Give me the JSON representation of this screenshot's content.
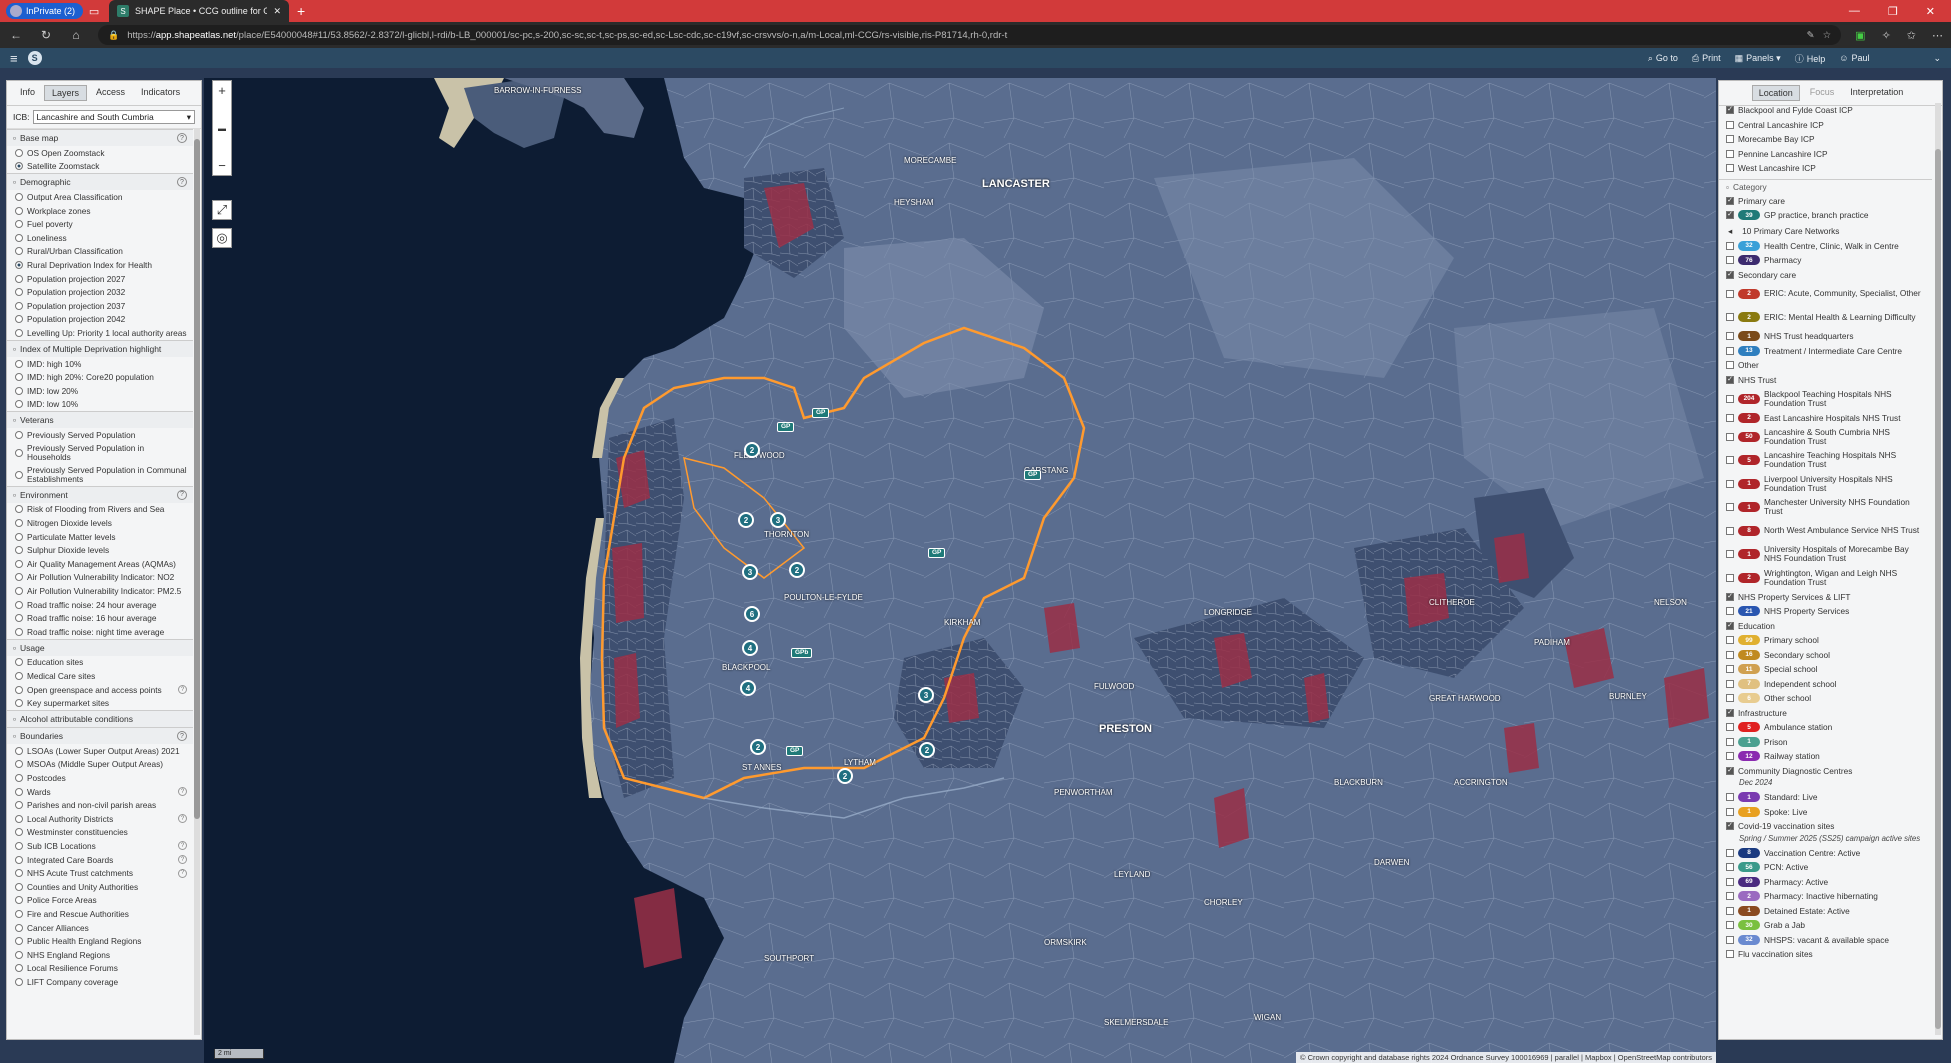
{
  "browser": {
    "private_label": "InPrivate (2)",
    "tab_title": "SHAPE Place • CCG outline for Gl",
    "url_prefix": "https://",
    "url_host": "app.shapeatlas.net",
    "url_path": "/place/E54000048#11/53.8562/-2.8372/l-glicbl,l-rdi/b-LB_000001/sc-pc,s-200,sc-sc,sc-t,sc-ps,sc-ed,sc-Lsc-cdc,sc-c19vf,sc-crsvvs/o-n,a/m-Local,ml-CCG/rs-visible,ris-P81714,rh-0,rdr-t"
  },
  "header": {
    "goto": "Go to",
    "print": "Print",
    "panels": "Panels",
    "help": "Help",
    "user": "Paul"
  },
  "left_panel": {
    "tabs": [
      "Info",
      "Layers",
      "Access",
      "Indicators"
    ],
    "active_tab": "Layers",
    "icb_label": "ICB:",
    "icb_value": "Lancashire and South Cumbria",
    "sections": [
      {
        "title": "Base map",
        "help": true,
        "items": [
          {
            "label": "OS Open Zoomstack",
            "on": false
          },
          {
            "label": "Satellite Zoomstack",
            "on": true
          }
        ]
      },
      {
        "title": "Demographic",
        "help": true,
        "items": [
          {
            "label": "Output Area Classification"
          },
          {
            "label": "Workplace zones"
          },
          {
            "label": "Fuel poverty"
          },
          {
            "label": "Loneliness"
          },
          {
            "label": "Rural/Urban Classification"
          },
          {
            "label": "Rural Deprivation Index for Health",
            "on": true
          },
          {
            "label": "Population projection 2027"
          },
          {
            "label": "Population projection 2032"
          },
          {
            "label": "Population projection 2037"
          },
          {
            "label": "Population projection 2042"
          },
          {
            "label": "Levelling Up: Priority 1 local authority areas"
          }
        ]
      },
      {
        "title": "Index of Multiple Deprivation highlight",
        "items": [
          {
            "label": "IMD: high 10%"
          },
          {
            "label": "IMD: high 20%: Core20 population"
          },
          {
            "label": "IMD: low 20%"
          },
          {
            "label": "IMD: low 10%"
          }
        ]
      },
      {
        "title": "Veterans",
        "items": [
          {
            "label": "Previously Served Population"
          },
          {
            "label": "Previously Served Population in Households",
            "tall": true
          },
          {
            "label": "Previously Served Population in Communal Establishments",
            "tall": true
          }
        ]
      },
      {
        "title": "Environment",
        "help": true,
        "items": [
          {
            "label": "Risk of Flooding from Rivers and Sea"
          },
          {
            "label": "Nitrogen Dioxide levels"
          },
          {
            "label": "Particulate Matter levels"
          },
          {
            "label": "Sulphur Dioxide levels"
          },
          {
            "label": "Air Quality Management Areas (AQMAs)"
          },
          {
            "label": "Air Pollution Vulnerability Indicator: NO2"
          },
          {
            "label": "Air Pollution Vulnerability Indicator: PM2.5"
          },
          {
            "label": "Road traffic noise: 24 hour average"
          },
          {
            "label": "Road traffic noise: 16 hour average"
          },
          {
            "label": "Road traffic noise: night time average"
          }
        ]
      },
      {
        "title": "Usage",
        "items": [
          {
            "label": "Education sites"
          },
          {
            "label": "Medical Care sites"
          },
          {
            "label": "Open greenspace and access points",
            "help": true
          },
          {
            "label": "Key supermarket sites"
          }
        ]
      },
      {
        "title": "Alcohol attributable conditions",
        "items": []
      },
      {
        "title": "Boundaries",
        "help": true,
        "items": [
          {
            "label": "LSOAs (Lower Super Output Areas) 2021"
          },
          {
            "label": "MSOAs (Middle Super Output Areas)"
          },
          {
            "label": "Postcodes"
          },
          {
            "label": "Wards",
            "help": true
          },
          {
            "label": "Parishes and non-civil parish areas"
          },
          {
            "label": "Local Authority Districts",
            "help": true
          },
          {
            "label": "Westminster constituencies"
          },
          {
            "label": "Sub ICB Locations",
            "help": true
          },
          {
            "label": "Integrated Care Boards",
            "help": true
          },
          {
            "label": "NHS Acute Trust catchments",
            "help": true
          },
          {
            "label": "Counties and Unity Authorities"
          },
          {
            "label": "Police Force Areas"
          },
          {
            "label": "Fire and Rescue Authorities"
          },
          {
            "label": "Cancer Alliances"
          },
          {
            "label": "Public Health England Regions"
          },
          {
            "label": "NHS England Regions"
          },
          {
            "label": "Local Resilience Forums"
          },
          {
            "label": "LIFT Company coverage"
          }
        ]
      }
    ]
  },
  "map": {
    "scale": "2 mi",
    "attribution": "© Crown copyright and database rights 2024 Ordnance Survey 100016969 | parallel | Mapbox | OpenStreetMap contributors",
    "places": {
      "lancaster": "LANCASTER",
      "preston": "PRESTON",
      "blackpool": "BLACKPOOL",
      "fleetwood": "FLEETWOOD",
      "thornton": "THORNTON",
      "heysham": "HEYSHAM",
      "morecambe": "MORECAMBE",
      "st_annes": "ST ANNES",
      "lytham": "LYTHAM",
      "garstang": "GARSTANG",
      "fulwood": "FULWOOD",
      "chorley": "CHORLEY",
      "leyland": "LEYLAND",
      "blackburn": "BLACKBURN",
      "darwen": "DARWEN",
      "southport": "SOUTHPORT",
      "barrow": "BARROW-IN-FURNESS",
      "burnley": "BURNLEY",
      "accrington": "ACCRINGTON",
      "great_harwood": "GREAT HARWOOD",
      "clitheroe": "CLITHEROE",
      "longridge": "LONGRIDGE",
      "kirkham": "KIRKHAM",
      "poulton": "POULTON-LE-FYLDE",
      "nelson": "NELSON",
      "padiham": "PADIHAM",
      "wigan": "WIGAN",
      "ormskirk": "ORMSKIRK",
      "skelmersdale": "SKELMERSDALE",
      "penwortham": "PENWORTHAM"
    },
    "markers": [
      "2",
      "2",
      "3",
      "3",
      "2",
      "6",
      "4",
      "4",
      "3",
      "2",
      "2",
      "2"
    ],
    "gp_chip": "GP",
    "gp_chip_b": "GPb"
  },
  "right_panel": {
    "tabs": [
      "Location",
      "Focus",
      "Interpretation"
    ],
    "active_tab": "Location",
    "icp_items": [
      {
        "label": "Blackpool and Fylde Coast ICP",
        "on": true
      },
      {
        "label": "Central Lancashire ICP",
        "on": false
      },
      {
        "label": "Morecambe Bay ICP",
        "on": false
      },
      {
        "label": "Pennine Lancashire ICP",
        "on": false
      },
      {
        "label": "West Lancashire ICP",
        "on": false
      }
    ],
    "category_label": "Category",
    "groups": [
      {
        "title": "Primary care",
        "on": true,
        "items": [
          {
            "count": "39",
            "label": "GP practice, branch practice",
            "color": "#1f7a78",
            "on": true
          }
        ]
      },
      {
        "pcn": "10 Primary Care Networks"
      },
      {
        "items": [
          {
            "count": "32",
            "label": "Health Centre, Clinic, Walk in Centre",
            "color": "#3aa0d8"
          },
          {
            "count": "76",
            "label": "Pharmacy",
            "color": "#3b2a6e"
          }
        ]
      },
      {
        "title": "Secondary care",
        "on": true,
        "items": [
          {
            "count": "2",
            "label": "ERIC: Acute, Community, Specialist, Other",
            "color": "#c0392b",
            "tall": true
          },
          {
            "count": "2",
            "label": "ERIC: Mental Health & Learning Difficulty",
            "color": "#8a7a10",
            "tall": true
          },
          {
            "count": "1",
            "label": "NHS Trust headquarters",
            "color": "#7a4a1a"
          },
          {
            "count": "13",
            "label": "Treatment / Intermediate Care Centre",
            "color": "#2f7fbf"
          }
        ]
      },
      {
        "title": "Other",
        "on": false,
        "items": []
      },
      {
        "title": "NHS Trust",
        "on": true,
        "items": [
          {
            "count": "204",
            "label": "Blackpool Teaching Hospitals NHS Foundation Trust",
            "color": "#b0252a",
            "tall": true
          },
          {
            "count": "2",
            "label": "East Lancashire Hospitals NHS Trust",
            "color": "#b0252a"
          },
          {
            "count": "50",
            "label": "Lancashire & South Cumbria NHS Foundation Trust",
            "color": "#b0252a",
            "tall": true
          },
          {
            "count": "5",
            "label": "Lancashire Teaching Hospitals NHS Foundation Trust",
            "color": "#b0252a",
            "tall": true
          },
          {
            "count": "1",
            "label": "Liverpool University Hospitals NHS Foundation Trust",
            "color": "#b0252a",
            "tall": true
          },
          {
            "count": "1",
            "label": "Manchester University NHS Foundation Trust",
            "color": "#b0252a",
            "tall": true
          },
          {
            "count": "8",
            "label": "North West Ambulance Service NHS Trust",
            "color": "#b0252a",
            "tall": true
          },
          {
            "count": "1",
            "label": "University Hospitals of Morecambe Bay NHS Foundation Trust",
            "color": "#b0252a",
            "tall": true
          },
          {
            "count": "2",
            "label": "Wrightington, Wigan and Leigh NHS Foundation Trust",
            "color": "#b0252a",
            "tall": true
          }
        ]
      },
      {
        "title": "NHS Property Services & LIFT",
        "on": true,
        "items": [
          {
            "count": "21",
            "label": "NHS Property Services",
            "color": "#2a56b0"
          }
        ]
      },
      {
        "title": "Education",
        "on": true,
        "items": [
          {
            "count": "99",
            "label": "Primary school",
            "color": "#e0b030"
          },
          {
            "count": "16",
            "label": "Secondary school",
            "color": "#c08a20"
          },
          {
            "count": "11",
            "label": "Special school",
            "color": "#d0a050"
          },
          {
            "count": "7",
            "label": "Independent school",
            "color": "#e0c080"
          },
          {
            "count": "6",
            "label": "Other school",
            "color": "#e8cc90"
          }
        ]
      },
      {
        "title": "Infrastructure",
        "on": true,
        "items": [
          {
            "count": "5",
            "label": "Ambulance station",
            "color": "#e02020"
          },
          {
            "count": "1",
            "label": "Prison",
            "color": "#4aa090"
          },
          {
            "count": "12",
            "label": "Railway station",
            "color": "#8a2ab0"
          }
        ]
      },
      {
        "title": "Community Diagnostic Centres",
        "on": true,
        "note": "Dec 2024",
        "items": [
          {
            "count": "1",
            "label": "Standard: Live",
            "color": "#7a3ab0"
          },
          {
            "count": "1",
            "label": "Spoke: Live",
            "color": "#e8a020"
          }
        ]
      },
      {
        "title": "Covid-19 vaccination sites",
        "on": true,
        "note": "Spring / Summer 2025 (SS25) campaign active sites",
        "items": [
          {
            "count": "8",
            "label": "Vaccination Centre: Active",
            "color": "#1a3a80"
          },
          {
            "count": "56",
            "label": "PCN: Active",
            "color": "#3a9a8a"
          },
          {
            "count": "69",
            "label": "Pharmacy: Active",
            "color": "#4a2a80"
          },
          {
            "count": "2",
            "label": "Pharmacy: Inactive hibernating",
            "color": "#9a6ac0"
          },
          {
            "count": "1",
            "label": "Detained Estate: Active",
            "color": "#8a4a20"
          },
          {
            "count": "30",
            "label": "Grab a Jab",
            "color": "#7ac040"
          },
          {
            "count": "32",
            "label": "NHSPS: vacant & available space",
            "color": "#6a8ad0"
          }
        ]
      },
      {
        "title": "Flu vaccination sites",
        "on": false,
        "items": []
      }
    ]
  }
}
